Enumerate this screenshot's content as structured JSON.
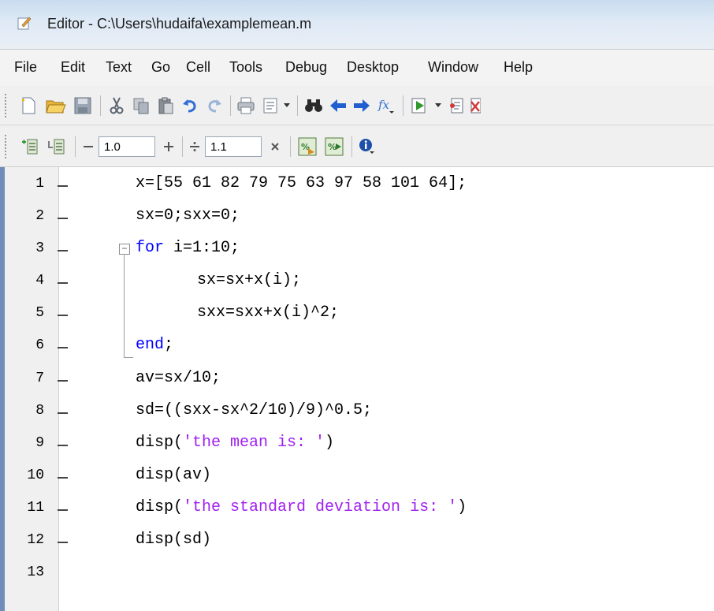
{
  "window": {
    "title": "Editor - C:\\Users\\hudaifa\\examplemean.m"
  },
  "menu": [
    "File",
    "Edit",
    "Text",
    "Go",
    "Cell",
    "Tools",
    "Debug",
    "Desktop",
    "Window",
    "Help"
  ],
  "toolbar": {
    "cell_decrement_value": "1.0",
    "cell_divide_value": "1.1"
  },
  "code_lines": [
    {
      "num": "1",
      "text": "x=[55 61 82 79 75 63 97 58 101 64];"
    },
    {
      "num": "2",
      "text": "sx=0;sxx=0;"
    },
    {
      "num": "3",
      "keyword": "for",
      "text": " i=1:10;"
    },
    {
      "num": "4",
      "text": "sx=sx+x(i);"
    },
    {
      "num": "5",
      "text": "sxx=sxx+x(i)^2;"
    },
    {
      "num": "6",
      "keyword": "end",
      "text": ";"
    },
    {
      "num": "7",
      "text": "av=sx/10;"
    },
    {
      "num": "8",
      "text": "sd=((sxx-sx^2/10)/9)^0.5;"
    },
    {
      "num": "9",
      "func": "disp(",
      "string": "'the mean is: '",
      "close": ")"
    },
    {
      "num": "10",
      "text": "disp(av)"
    },
    {
      "num": "11",
      "func": "disp(",
      "string": "'the standard deviation is: '",
      "close": ")"
    },
    {
      "num": "12",
      "text": "disp(sd)"
    },
    {
      "num": "13",
      "text": ""
    }
  ],
  "colors": {
    "keyword": "#0000ff",
    "string": "#a020f0"
  }
}
